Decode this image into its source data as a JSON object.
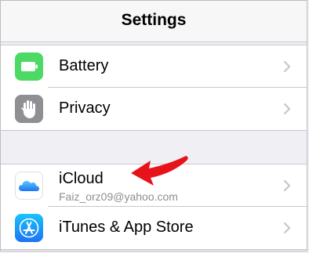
{
  "nav": {
    "title": "Settings"
  },
  "group1": {
    "rows": [
      {
        "label": "Battery",
        "icon": "battery-icon",
        "color": "#4cd964"
      },
      {
        "label": "Privacy",
        "icon": "hand-icon",
        "color": "#8e8e93"
      }
    ]
  },
  "group2": {
    "rows": [
      {
        "label": "iCloud",
        "sublabel": "Faiz_orz09@yahoo.com",
        "icon": "icloud-icon",
        "color": "#ffffff"
      },
      {
        "label": "iTunes & App Store",
        "icon": "app-store-icon",
        "color": "#1e88f5"
      }
    ]
  },
  "annotation": {
    "icon": "red-arrow-icon",
    "color": "#e8121a"
  }
}
